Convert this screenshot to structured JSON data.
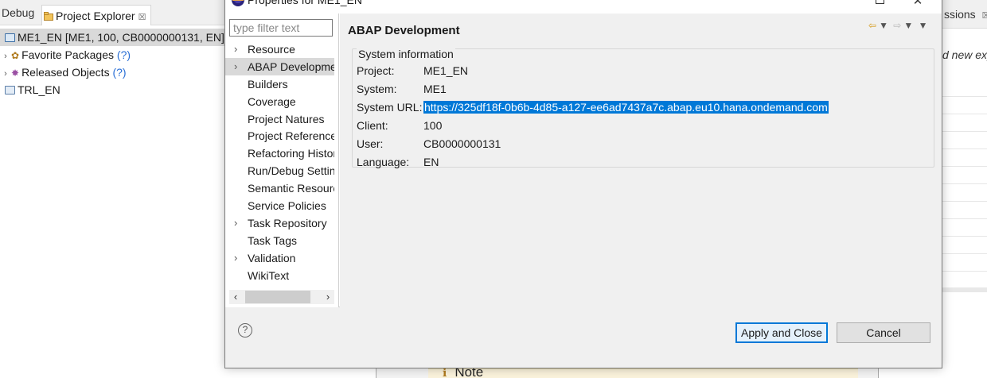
{
  "workbench": {
    "tabs": {
      "debug": "Debug",
      "project_explorer": "Project Explorer"
    },
    "tree": [
      {
        "label": "ME1_EN [ME1, 100, CB0000000131, EN]",
        "selected": true
      },
      {
        "label": "Favorite Packages",
        "suffix": "(?)"
      },
      {
        "label": "Released Objects",
        "suffix": "(?)"
      },
      {
        "label": "TRL_EN"
      }
    ],
    "right_tab": "ssions",
    "right_text": "d new exp",
    "note_text": "Note"
  },
  "dialog": {
    "title": "Properties for ME1_EN",
    "filter_placeholder": "type filter text",
    "nav_items": [
      {
        "label": "Resource",
        "expandable": true
      },
      {
        "label": "ABAP Development",
        "expandable": true,
        "selected": true
      },
      {
        "label": "Builders"
      },
      {
        "label": "Coverage"
      },
      {
        "label": "Project Natures"
      },
      {
        "label": "Project References"
      },
      {
        "label": "Refactoring History"
      },
      {
        "label": "Run/Debug Settings"
      },
      {
        "label": "Semantic Resource"
      },
      {
        "label": "Service Policies"
      },
      {
        "label": "Task Repository",
        "expandable": true
      },
      {
        "label": "Task Tags"
      },
      {
        "label": "Validation",
        "expandable": true
      },
      {
        "label": "WikiText"
      }
    ],
    "content_title": "ABAP Development",
    "group_title": "System information",
    "fields": [
      {
        "label": "Project:",
        "value": "ME1_EN"
      },
      {
        "label": "System:",
        "value": "ME1"
      },
      {
        "label": "System URL:",
        "value": "https://325df18f-0b6b-4d85-a127-ee6ad7437a7c.abap.eu10.hana.ondemand.com",
        "selected": true
      },
      {
        "label": "Client:",
        "value": "100"
      },
      {
        "label": "User:",
        "value": "CB0000000131"
      },
      {
        "label": "Language:",
        "value": "EN"
      }
    ],
    "buttons": {
      "apply": "Apply and Close",
      "cancel": "Cancel"
    },
    "help_symbol": "?"
  },
  "colors": {
    "selection": "#0078d7",
    "nav_selected": "#d9d9d9",
    "dialog_bg": "#f0f0f0"
  }
}
